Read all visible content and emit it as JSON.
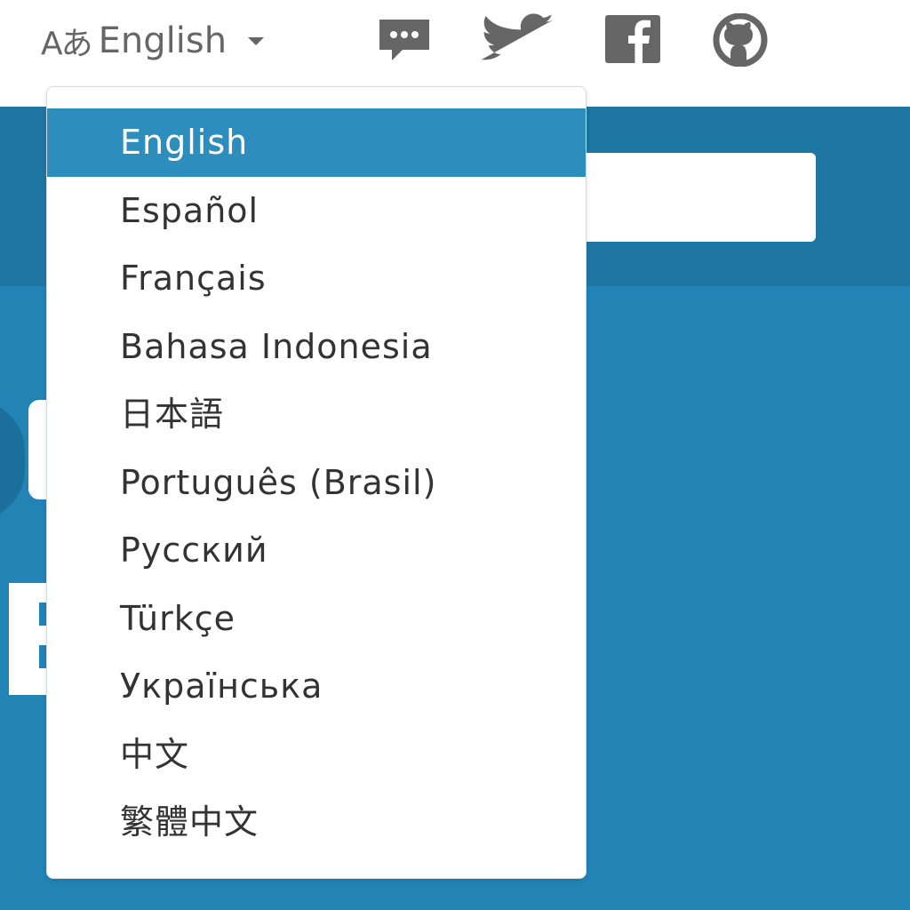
{
  "language_selector": {
    "icon": "translate-icon",
    "icon_glyph": "Aあ",
    "current": "English"
  },
  "social": [
    {
      "name": "chat-icon"
    },
    {
      "name": "twitter-icon"
    },
    {
      "name": "facebook-icon"
    },
    {
      "name": "github-icon"
    }
  ],
  "menu": {
    "items": [
      {
        "label": "English",
        "active": true
      },
      {
        "label": "Español"
      },
      {
        "label": "Français"
      },
      {
        "label": "Bahasa Indonesia"
      },
      {
        "label": "日本語"
      },
      {
        "label": "Português (Brasil)"
      },
      {
        "label": "Русский"
      },
      {
        "label": "Türkçe"
      },
      {
        "label": "Українська"
      },
      {
        "label": "中文"
      },
      {
        "label": "繁體中文"
      }
    ]
  },
  "colors": {
    "accent": "#2d8ebd",
    "background": "#2184b5",
    "band": "#1e76a3",
    "icon_gray": "#666666"
  }
}
